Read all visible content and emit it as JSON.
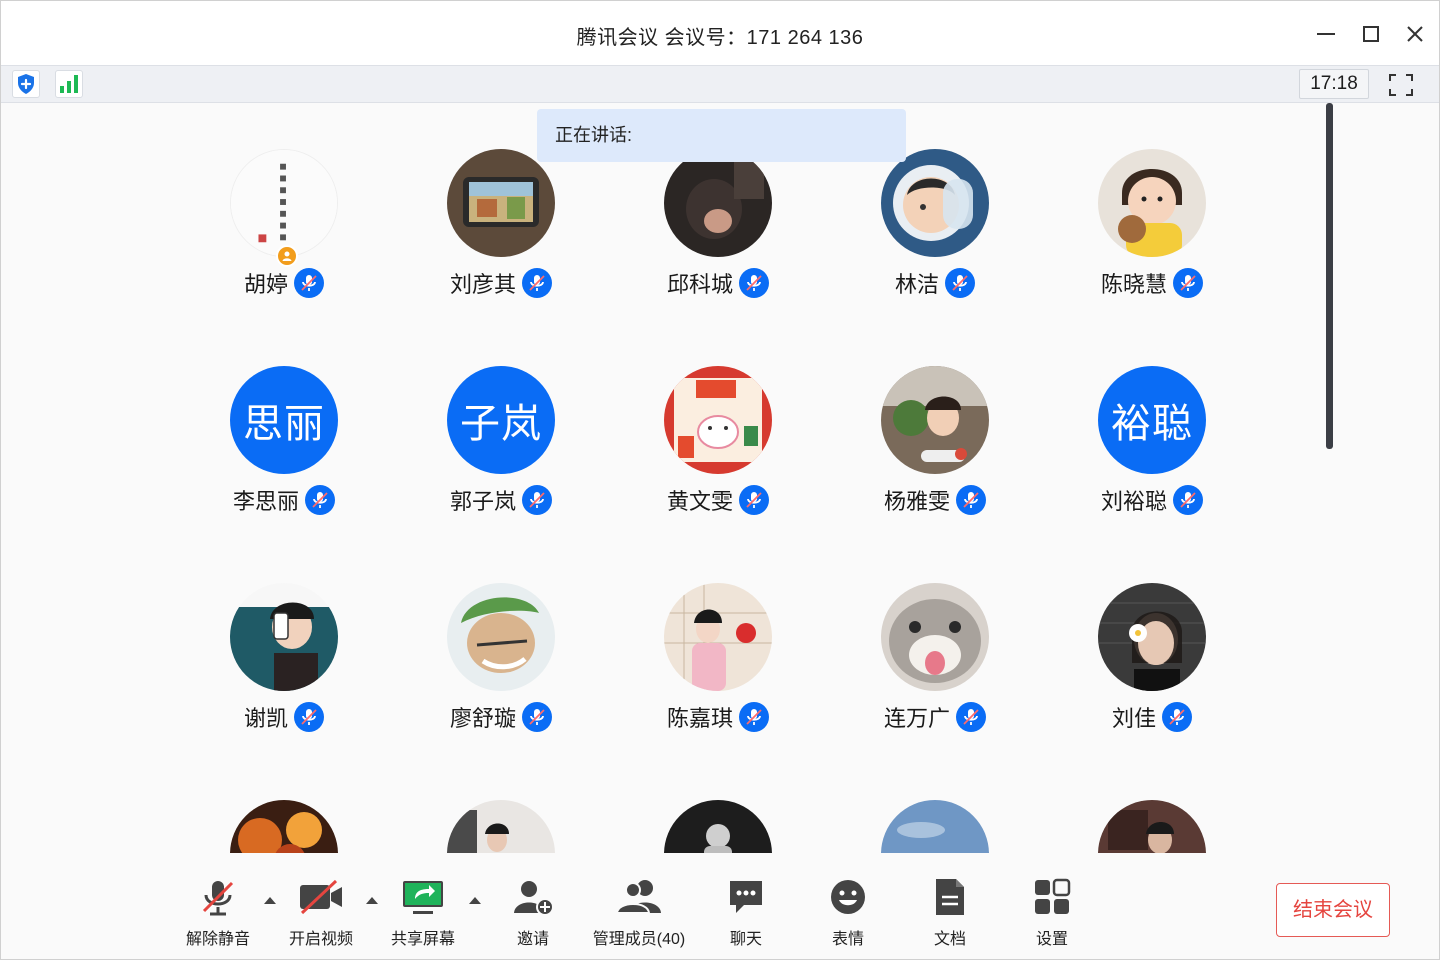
{
  "window": {
    "title": "腾讯会议 会议号：171 264 136",
    "clock": "17:18"
  },
  "banner": {
    "speaking_label": "正在讲话:"
  },
  "participants": [
    {
      "name": "胡婷",
      "avatar_type": "image",
      "avatar_desc": "calligraphy-on-white",
      "host": true
    },
    {
      "name": "刘彦其",
      "avatar_type": "image",
      "avatar_desc": "scenery-photo"
    },
    {
      "name": "邱科城",
      "avatar_type": "image",
      "avatar_desc": "person-dark-photo"
    },
    {
      "name": "林洁",
      "avatar_type": "image",
      "avatar_desc": "astronaut-illustration"
    },
    {
      "name": "陈晓慧",
      "avatar_type": "image",
      "avatar_desc": "child-with-teddy"
    },
    {
      "name": "李思丽",
      "avatar_type": "text",
      "avatar_text": "思丽"
    },
    {
      "name": "郭子岚",
      "avatar_type": "text",
      "avatar_text": "子岚"
    },
    {
      "name": "黄文雯",
      "avatar_type": "image",
      "avatar_desc": "good-luck-card"
    },
    {
      "name": "杨雅雯",
      "avatar_type": "image",
      "avatar_desc": "girl-with-plants"
    },
    {
      "name": "刘裕聪",
      "avatar_type": "text",
      "avatar_text": "裕聪"
    },
    {
      "name": "谢凯",
      "avatar_type": "image",
      "avatar_desc": "cartoon-boy-phone"
    },
    {
      "name": "廖舒璇",
      "avatar_type": "image",
      "avatar_desc": "anime-green-hair"
    },
    {
      "name": "陈嘉琪",
      "avatar_type": "image",
      "avatar_desc": "girl-pink-kimono"
    },
    {
      "name": "连万广",
      "avatar_type": "image",
      "avatar_desc": "cat-tongue"
    },
    {
      "name": "刘佳",
      "avatar_type": "image",
      "avatar_desc": "girl-with-flower"
    },
    {
      "name": "",
      "avatar_type": "image",
      "avatar_desc": "fire-orange"
    },
    {
      "name": "",
      "avatar_type": "image",
      "avatar_desc": "person-in-room"
    },
    {
      "name": "",
      "avatar_type": "image",
      "avatar_desc": "astronaut-dark"
    },
    {
      "name": "",
      "avatar_type": "image",
      "avatar_desc": "blue-sky"
    },
    {
      "name": "",
      "avatar_type": "image",
      "avatar_desc": "woman-dark-bg"
    }
  ],
  "toolbar": {
    "unmute": "解除静音",
    "start_video": "开启视频",
    "share_screen": "共享屏幕",
    "invite": "邀请",
    "manage_members": "管理成员(40)",
    "chat": "聊天",
    "reactions": "表情",
    "docs": "文档",
    "settings": "设置",
    "end_meeting": "结束会议"
  },
  "colors": {
    "accent_blue": "#0a6cf5",
    "end_red": "#e5453f",
    "share_green": "#1fb35a",
    "signal_green": "#1db954"
  },
  "icons": [
    "shield-icon",
    "signal-icon",
    "fullscreen-icon",
    "mic-muted-icon",
    "video-off-icon",
    "share-screen-icon",
    "invite-icon",
    "members-icon",
    "chat-icon",
    "emoji-icon",
    "doc-icon",
    "settings-icon"
  ]
}
